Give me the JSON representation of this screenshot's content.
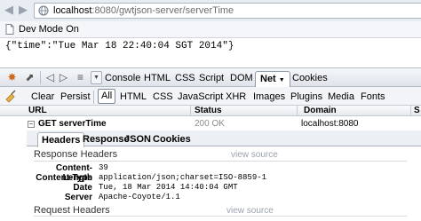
{
  "browser": {
    "url_host": "localhost",
    "url_path": ":8080/gwtjson-server/serverTime",
    "back_icon": "arrow-left-icon",
    "forward_icon": "arrow-right-icon"
  },
  "bookmarks": {
    "items": [
      {
        "label": "Dev Mode On",
        "icon": "page-icon"
      }
    ]
  },
  "page": {
    "json_text": "{\"time\":\"Tue Mar 18 22:40:04 SGT 2014\"}"
  },
  "firebug": {
    "main_tabs": [
      {
        "label": "Console"
      },
      {
        "label": "HTML"
      },
      {
        "label": "CSS"
      },
      {
        "label": "Script"
      },
      {
        "label": "DOM"
      },
      {
        "label": "Net",
        "active": true
      },
      {
        "label": "Cookies"
      }
    ],
    "filter": {
      "clear": "Clear",
      "persist": "Persist",
      "options": [
        "All",
        "HTML",
        "CSS",
        "JavaScript",
        "XHR",
        "Images",
        "Plugins",
        "Media",
        "Fonts"
      ],
      "selected": "All"
    },
    "columns": [
      "URL",
      "Status",
      "Domain",
      "S"
    ],
    "request": {
      "url": "GET serverTime",
      "status": "200 OK",
      "domain": "localhost:8080"
    },
    "detail_tabs": [
      "Headers",
      "Response",
      "JSON",
      "Cookies"
    ],
    "response_headers": {
      "title": "Response Headers",
      "view_source": "view source",
      "rows": [
        {
          "name": "Content-Length",
          "value": "39"
        },
        {
          "name": "Content-Type",
          "value": "application/json;charset=ISO-8859-1"
        },
        {
          "name": "Date",
          "value": "Tue, 18 Mar 2014 14:40:04 GMT"
        },
        {
          "name": "Server",
          "value": "Apache-Coyote/1.1"
        }
      ]
    },
    "request_headers": {
      "title": "Request Headers",
      "view_source": "view source"
    }
  },
  "colors": {
    "toolbar_bg": "#dfe4ea",
    "status_gray": "#8c8c8c",
    "view_source": "#9aa3ad"
  }
}
